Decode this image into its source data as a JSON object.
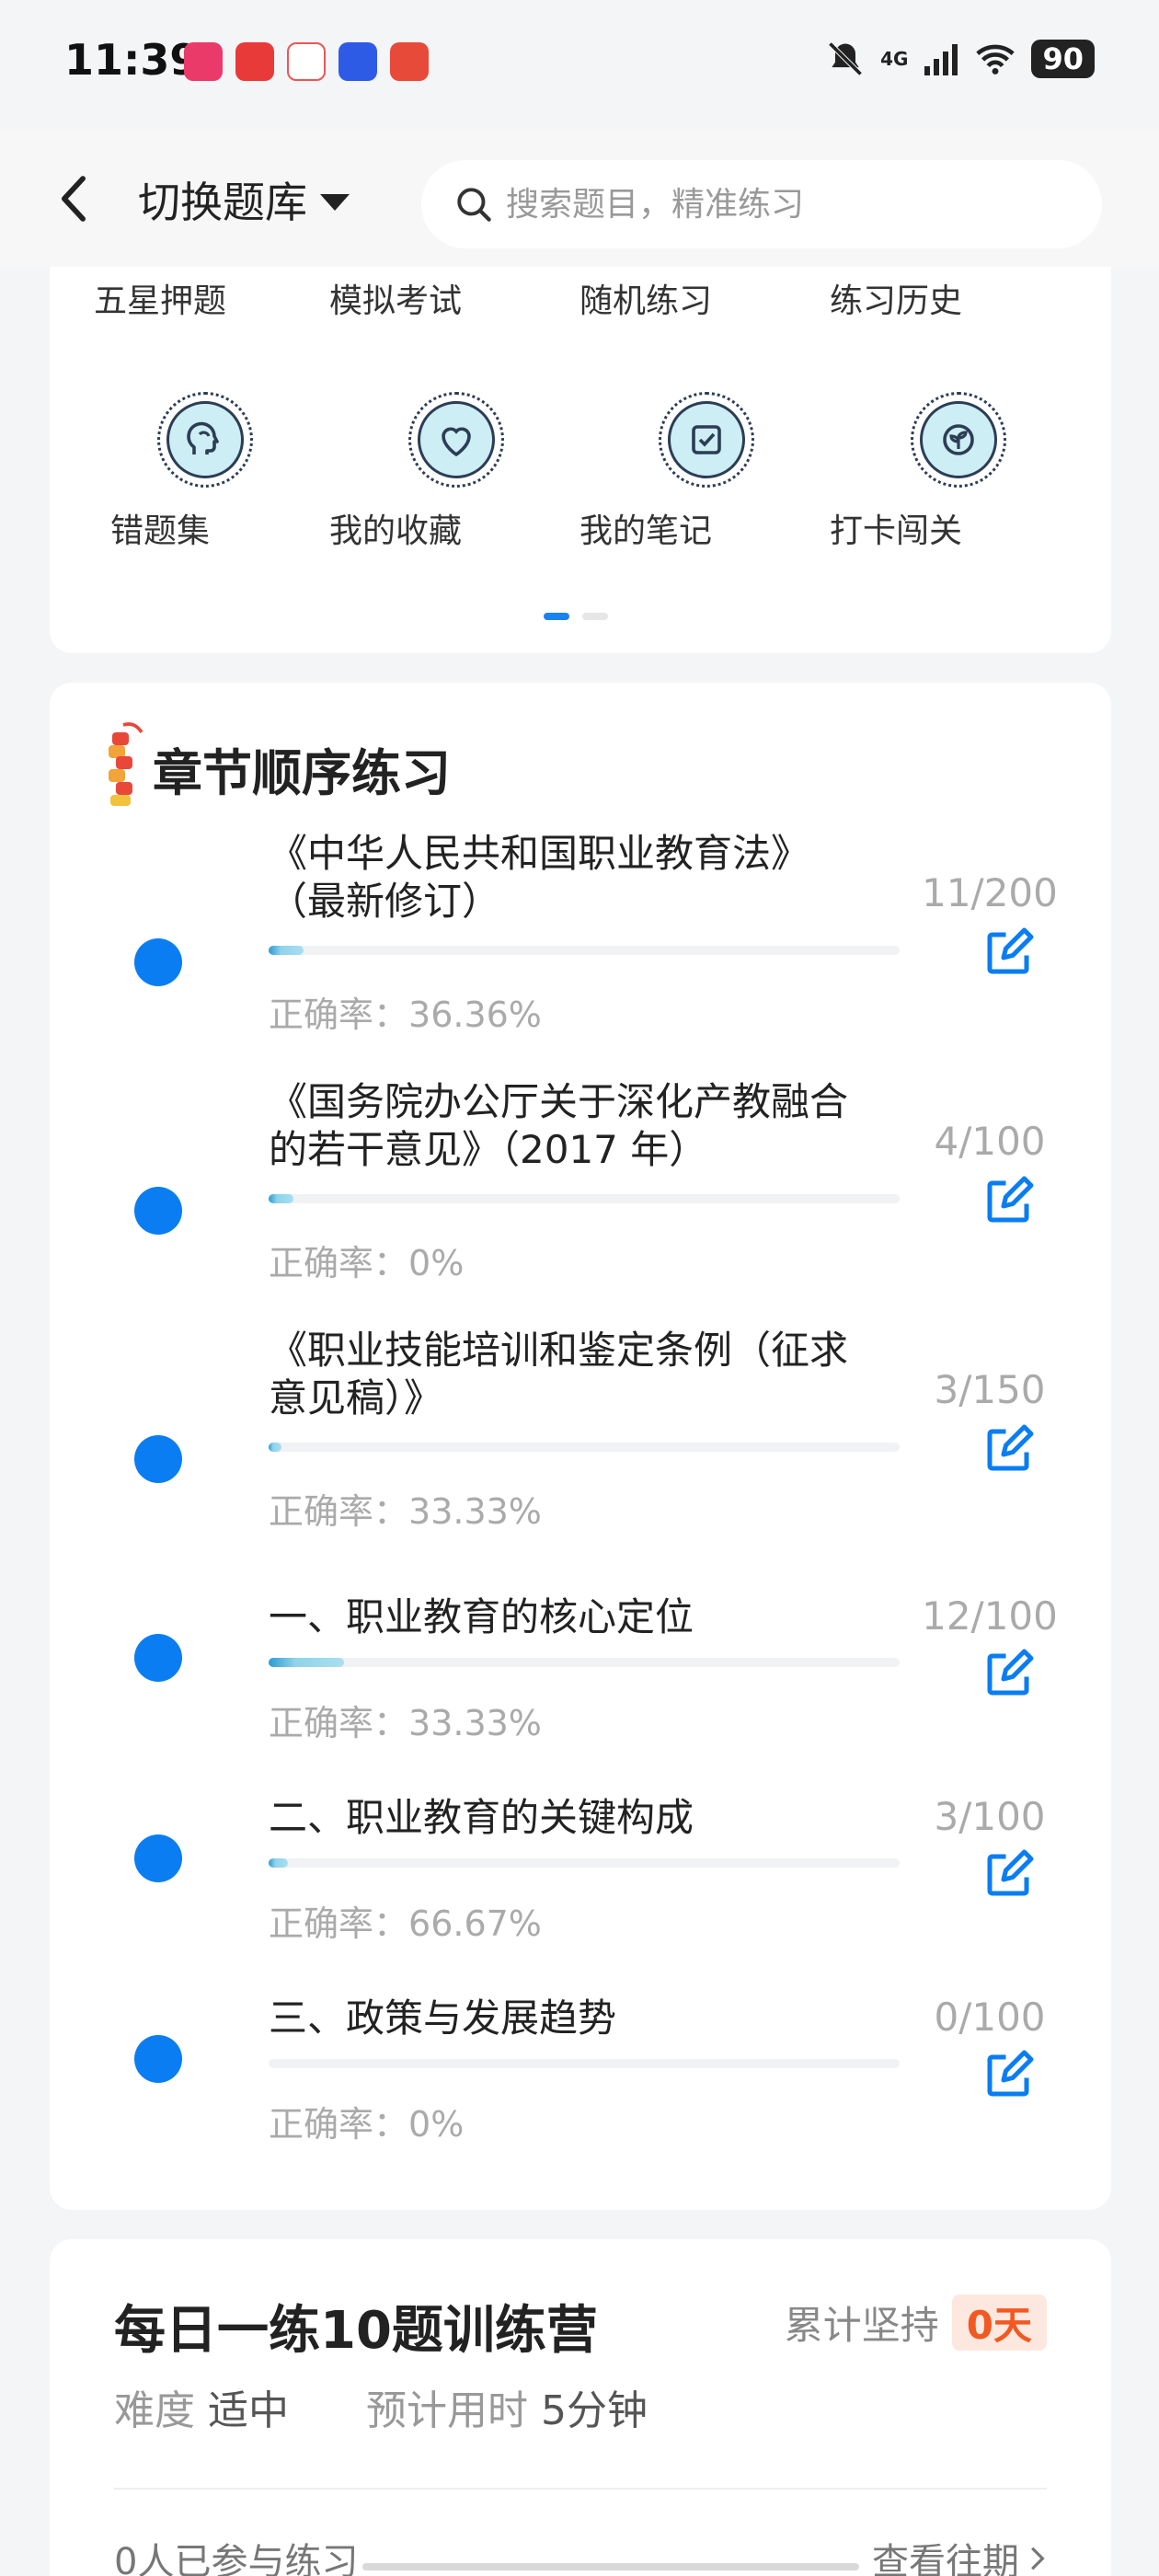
{
  "status_bar": {
    "time": "11:39",
    "battery": "90",
    "network": "4G"
  },
  "header": {
    "switch_label": "切换题库",
    "search_placeholder": "搜索题目，精准练习"
  },
  "grid": {
    "row1": [
      "五星押题",
      "模拟考试",
      "随机练习",
      "练习历史"
    ],
    "row2": [
      {
        "label": "错题集",
        "icon": "head-icon"
      },
      {
        "label": "我的收藏",
        "icon": "heart-icon"
      },
      {
        "label": "我的笔记",
        "icon": "note-check-icon"
      },
      {
        "label": "打卡闯关",
        "icon": "leaf-icon"
      }
    ]
  },
  "chapter": {
    "title": "章节顺序练习",
    "accuracy_prefix": "正确率：",
    "items": [
      {
        "title_line1": "《中华人民共和国职业教育法》",
        "title_line2": "（最新修订）",
        "count": "11/200",
        "accuracy": "36.36%",
        "progress": 0.055
      },
      {
        "title_line1": "《国务院办公厅关于深化产教融合",
        "title_line2": "的若干意见》（2017 年）",
        "count": "4/100",
        "accuracy": "0%",
        "progress": 0.04
      },
      {
        "title_line1": "《职业技能培训和鉴定条例（征求",
        "title_line2": "意见稿）》",
        "count": "3/150",
        "accuracy": "33.33%",
        "progress": 0.02
      },
      {
        "title_line1": "一、职业教育的核心定位",
        "title_line2": "",
        "count": "12/100",
        "accuracy": "33.33%",
        "progress": 0.12
      },
      {
        "title_line1": "二、职业教育的关键构成",
        "title_line2": "",
        "count": "3/100",
        "accuracy": "66.67%",
        "progress": 0.03
      },
      {
        "title_line1": "三、政策与发展趋势",
        "title_line2": "",
        "count": "0/100",
        "accuracy": "0%",
        "progress": 0.0
      }
    ]
  },
  "daily": {
    "title": "每日一练10题训练营",
    "persist_label": "累计坚持",
    "persist_days": "0天",
    "difficulty_label": "难度",
    "difficulty_value": "适中",
    "time_label": "预计用时",
    "time_value": "5分钟",
    "joined": "0人已参与练习",
    "history": "查看往期"
  },
  "colors": {
    "accent": "#0a7df2",
    "badge": "#f05a22"
  }
}
